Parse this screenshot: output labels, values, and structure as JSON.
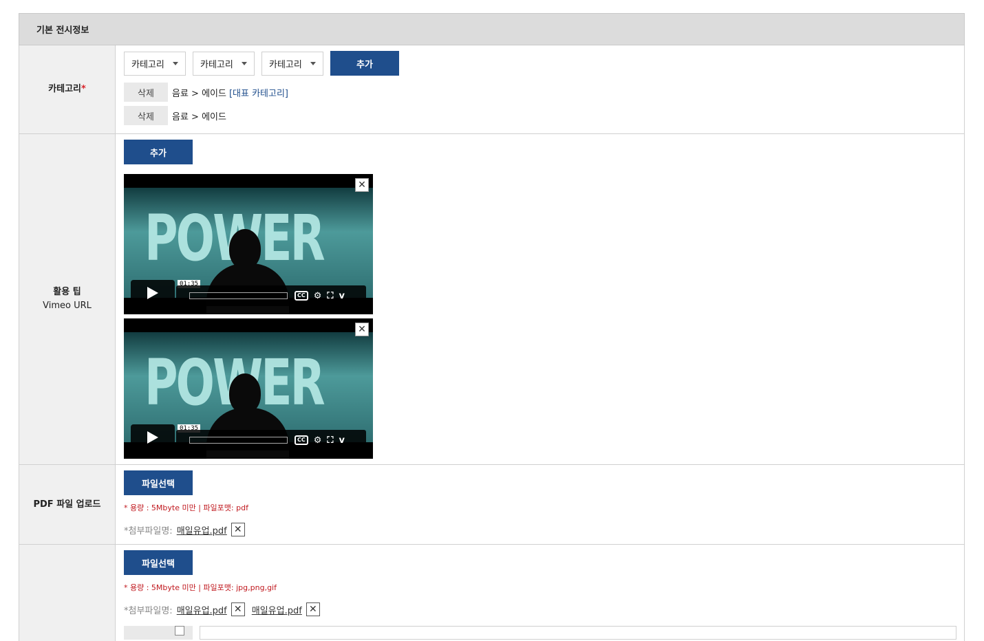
{
  "section": {
    "title": "기본 전시정보"
  },
  "category": {
    "label": "카테고리",
    "required_mark": "*",
    "selects": [
      "카테고리",
      "카테고리",
      "카테고리"
    ],
    "add_label": "추가",
    "items": [
      {
        "delete_label": "삭제",
        "path": "음료 > 에이드",
        "rep": "[대표 카테고리]"
      },
      {
        "delete_label": "삭제",
        "path": "음료 > 에이드",
        "rep": ""
      }
    ]
  },
  "vimeo": {
    "label_line1": "활용 팁",
    "label_line2": "Vimeo URL",
    "add_label": "추가",
    "videos": [
      {
        "title_text": "POWER",
        "time": "01:35",
        "close": "✕"
      },
      {
        "title_text": "POWER",
        "time": "01:35",
        "close": "✕"
      }
    ]
  },
  "pdf": {
    "label": "PDF 파일 업로드",
    "button": "파일선택",
    "note": "* 용량 : 5Mbyte 미만 | 파일포맷: pdf",
    "attach_label": "*첨부파일명:",
    "files": [
      "매일유업.pdf"
    ],
    "remove": "✕"
  },
  "image": {
    "button": "파일선택",
    "note": "* 용량 : 5Mbyte 미만 | 파일포맷: jpg,png,gif",
    "attach_label": "*첨부파일명:",
    "files": [
      "매일유업.pdf",
      "매일유업.pdf"
    ],
    "remove": "✕"
  }
}
